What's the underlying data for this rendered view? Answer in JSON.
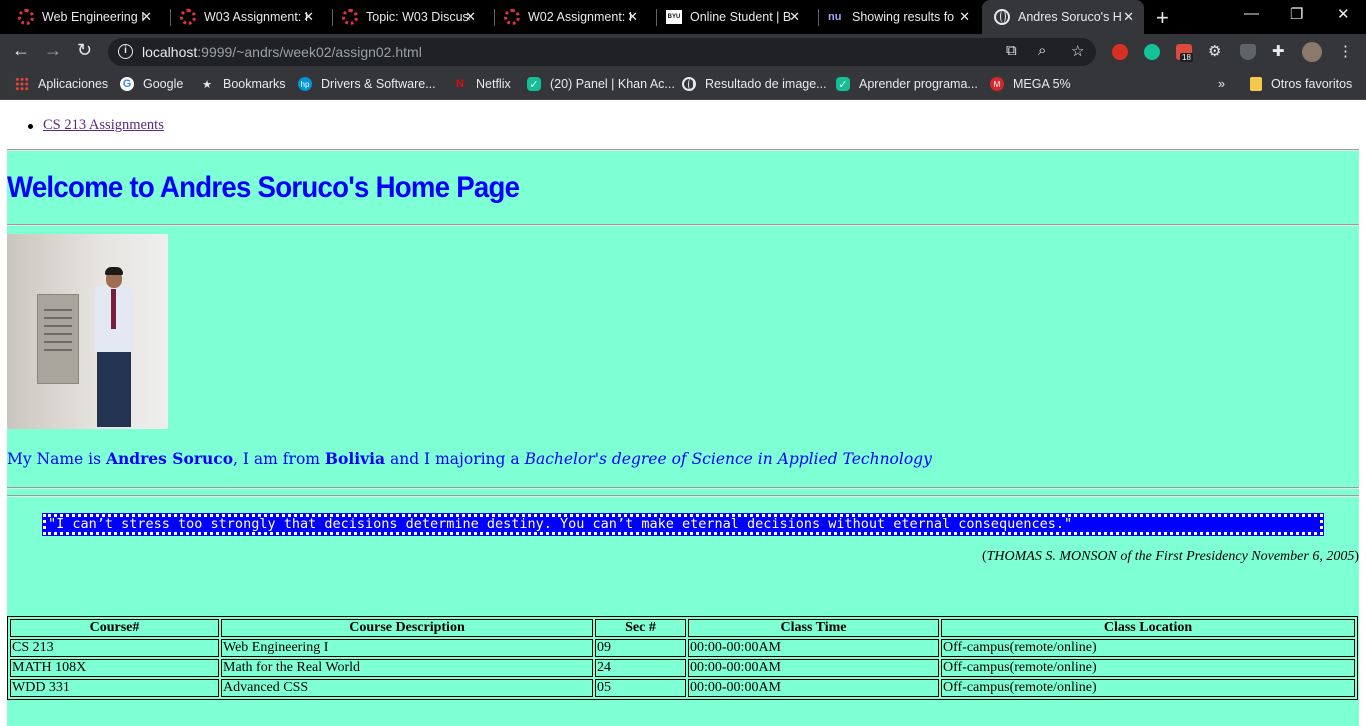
{
  "browser": {
    "tabs": [
      {
        "title": "Web Engineering I",
        "icon": "byui-ring-icon"
      },
      {
        "title": "W03 Assignment: I",
        "icon": "byui-ring-icon"
      },
      {
        "title": "Topic: W03 Discuss",
        "icon": "byui-ring-icon"
      },
      {
        "title": "W02 Assignment: I",
        "icon": "byui-ring-icon"
      },
      {
        "title": "Online Student | B",
        "icon": "byu-idaho-icon"
      },
      {
        "title": "Showing results fo",
        "icon": "nu-icon"
      },
      {
        "title": "Andres Soruco's H",
        "icon": "globe-icon",
        "active": true
      }
    ],
    "byu_favicon_text": "BYU",
    "nu_favicon_text": "nu",
    "url_host": "localhost",
    "url_path": ":9999/~andrs/week02/assign02.html",
    "extension_badge": "18",
    "bookmarks": [
      {
        "label": "Aplicaciones",
        "icon": "apps-grid-icon"
      },
      {
        "label": "Google",
        "icon": "google-icon"
      },
      {
        "label": "Bookmarks",
        "icon": "star-icon"
      },
      {
        "label": "Drivers & Software...",
        "icon": "hp-icon"
      },
      {
        "label": "Netflix",
        "icon": "netflix-icon"
      },
      {
        "label": "(20) Panel | Khan Ac...",
        "icon": "khan-icon"
      },
      {
        "label": "Resultado de image...",
        "icon": "globe-icon"
      },
      {
        "label": "Aprender programa...",
        "icon": "khan-icon"
      },
      {
        "label": "MEGA 5%",
        "icon": "mega-icon"
      }
    ],
    "other_bookmarks": "Otros favoritos",
    "colors": {
      "tab_bg": "#000000",
      "toolbar_bg": "#35363a",
      "omnibox_bg": "#202124"
    }
  },
  "page": {
    "nav_link": "CS 213 Assignments",
    "title": "Welcome to Andres Soruco's Home Page",
    "intro": {
      "prefix": "My Name is ",
      "name": "Andres Soruco",
      "mid1": ", I am from ",
      "country": "Bolivia",
      "mid2": " and I majoring a ",
      "degree": "Bachelor's degree of Science in Applied Technology"
    },
    "quote": "\"I can’t stress too strongly that decisions determine destiny. You can’t make eternal decisions without eternal consequences.\"",
    "attribution": {
      "open": "(",
      "text": "THOMAS S. MONSON of the First Presidency November 6, 2005",
      "close": ")"
    },
    "table": {
      "headers": [
        "Course#",
        "Course Description",
        "Sec #",
        "Class Time",
        "Class Location"
      ],
      "rows": [
        [
          "CS 213",
          "Web Engineering I",
          "09",
          "00:00-00:00AM",
          "Off-campus(remote/online)"
        ],
        [
          "MATH 108X",
          "Math for the Real World",
          "24",
          "00:00-00:00AM",
          "Off-campus(remote/online)"
        ],
        [
          "WDD 331",
          "Advanced CSS",
          "05",
          "00:00-00:00AM",
          "Off-campus(remote/online)"
        ]
      ]
    },
    "colors": {
      "background": "#7fffd4",
      "heading": "#0000ff",
      "quote_bg": "#0000ff"
    }
  }
}
